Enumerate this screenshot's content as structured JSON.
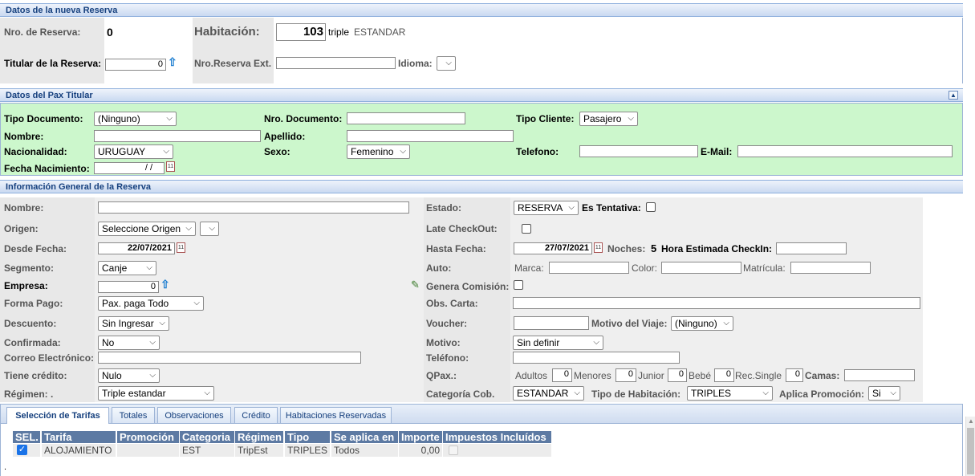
{
  "sections": {
    "reserva": "Datos de la nueva Reserva",
    "pax": "Datos del Pax Titular",
    "general": "Información General de la Reserva"
  },
  "reserva": {
    "nro_label": "Nro. de Reserva:",
    "nro_value": "0",
    "hab_label": "Habitación:",
    "hab_number": "103",
    "hab_type": "triple",
    "hab_category": "ESTANDAR",
    "titular_label": "Titular de la Reserva:",
    "titular_value": "0",
    "ext_label": "Nro.Reserva Ext.",
    "idioma_label": "Idioma:"
  },
  "pax": {
    "tipo_doc_label": "Tipo Documento:",
    "tipo_doc_value": "(Ninguno)",
    "nro_doc_label": "Nro. Documento:",
    "tipo_cliente_label": "Tipo Cliente:",
    "tipo_cliente_value": "Pasajero",
    "nombre_label": "Nombre:",
    "apellido_label": "Apellido:",
    "nacionalidad_label": "Nacionalidad:",
    "nacionalidad_value": "URUGUAY",
    "sexo_label": "Sexo:",
    "sexo_value": "Femenino",
    "telefono_label": "Telefono:",
    "email_label": "E-Mail:",
    "fecha_nac_label": "Fecha Nacimiento:",
    "fecha_nac_value": "/ /"
  },
  "general": {
    "nombre_label": "Nombre:",
    "origen_label": "Origen:",
    "origen_value": "Seleccione Origen",
    "desde_label": "Desde Fecha:",
    "desde_value": "22/07/2021",
    "segmento_label": "Segmento:",
    "segmento_value": "Canje",
    "empresa_label": "Empresa:",
    "empresa_value": "0",
    "forma_pago_label": "Forma Pago:",
    "forma_pago_value": "Pax. paga Todo",
    "descuento_label": "Descuento:",
    "descuento_value": "Sin Ingresar",
    "confirmada_label": "Confirmada:",
    "confirmada_value": "No",
    "correo_label": "Correo Electrónico:",
    "credito_label": "Tiene crédito:",
    "credito_value": "Nulo",
    "regimen_label": "Régimen: .",
    "regimen_value": "Triple estandar",
    "estado_label": "Estado:",
    "estado_value": "RESERVA",
    "tentativa_label": "Es Tentativa:",
    "late_label": "Late CheckOut:",
    "hasta_label": "Hasta Fecha:",
    "hasta_value": "27/07/2021",
    "noches_label": "Noches:",
    "noches_value": "5",
    "checkin_label": "Hora Estimada CheckIn:",
    "auto_label": "Auto:",
    "marca_label": "Marca:",
    "color_label": "Color:",
    "matricula_label": "Matrícula:",
    "comision_label": "Genera Comisión:",
    "obs_label": "Obs. Carta:",
    "voucher_label": "Voucher:",
    "motivo_viaje_label": "Motivo del Viaje:",
    "motivo_viaje_value": "(Ninguno)",
    "motivo_label": "Motivo:",
    "motivo_value": "Sin definir",
    "telefono_label": "Teléfono:",
    "qpax_label": "QPax.:",
    "adultos_label": "Adultos",
    "adultos_value": "0",
    "menores_label": "Menores",
    "menores_value": "0",
    "junior_label": "Junior",
    "junior_value": "0",
    "bebe_label": "Bebé",
    "bebe_value": "0",
    "recsingle_label": "Rec.Single",
    "recsingle_value": "0",
    "camas_label": "Camas:",
    "catcob_label": "Categoría Cob.",
    "catcob_value": "ESTANDAR",
    "tipohab_label": "Tipo de Habitación:",
    "tipohab_value": "TRIPLES",
    "promo_label": "Aplica Promoción:",
    "promo_value": "Si"
  },
  "tabs": [
    "Selección de Tarifas",
    "Totales",
    "Observaciones",
    "Crédito",
    "Habitaciones Reservadas"
  ],
  "table": {
    "headers": [
      "SEL.",
      "Tarifa",
      "Promoción",
      "Categoria",
      "Régimen",
      "Tipo",
      "Se aplica en",
      "Importe",
      "Impuestos Incluídos"
    ],
    "row": {
      "tarifa": "ALOJAMIENTO",
      "promocion": "",
      "categoria": "EST",
      "regimen": "TripEst",
      "tipo": "TRIPLES",
      "aplica": "Todos",
      "importe": "0,00"
    }
  },
  "footer_mark": ".",
  "colors": {
    "accent": "#16407e",
    "pax_bg": "#ccf7cc",
    "header_bg": "#5d7aa3"
  }
}
